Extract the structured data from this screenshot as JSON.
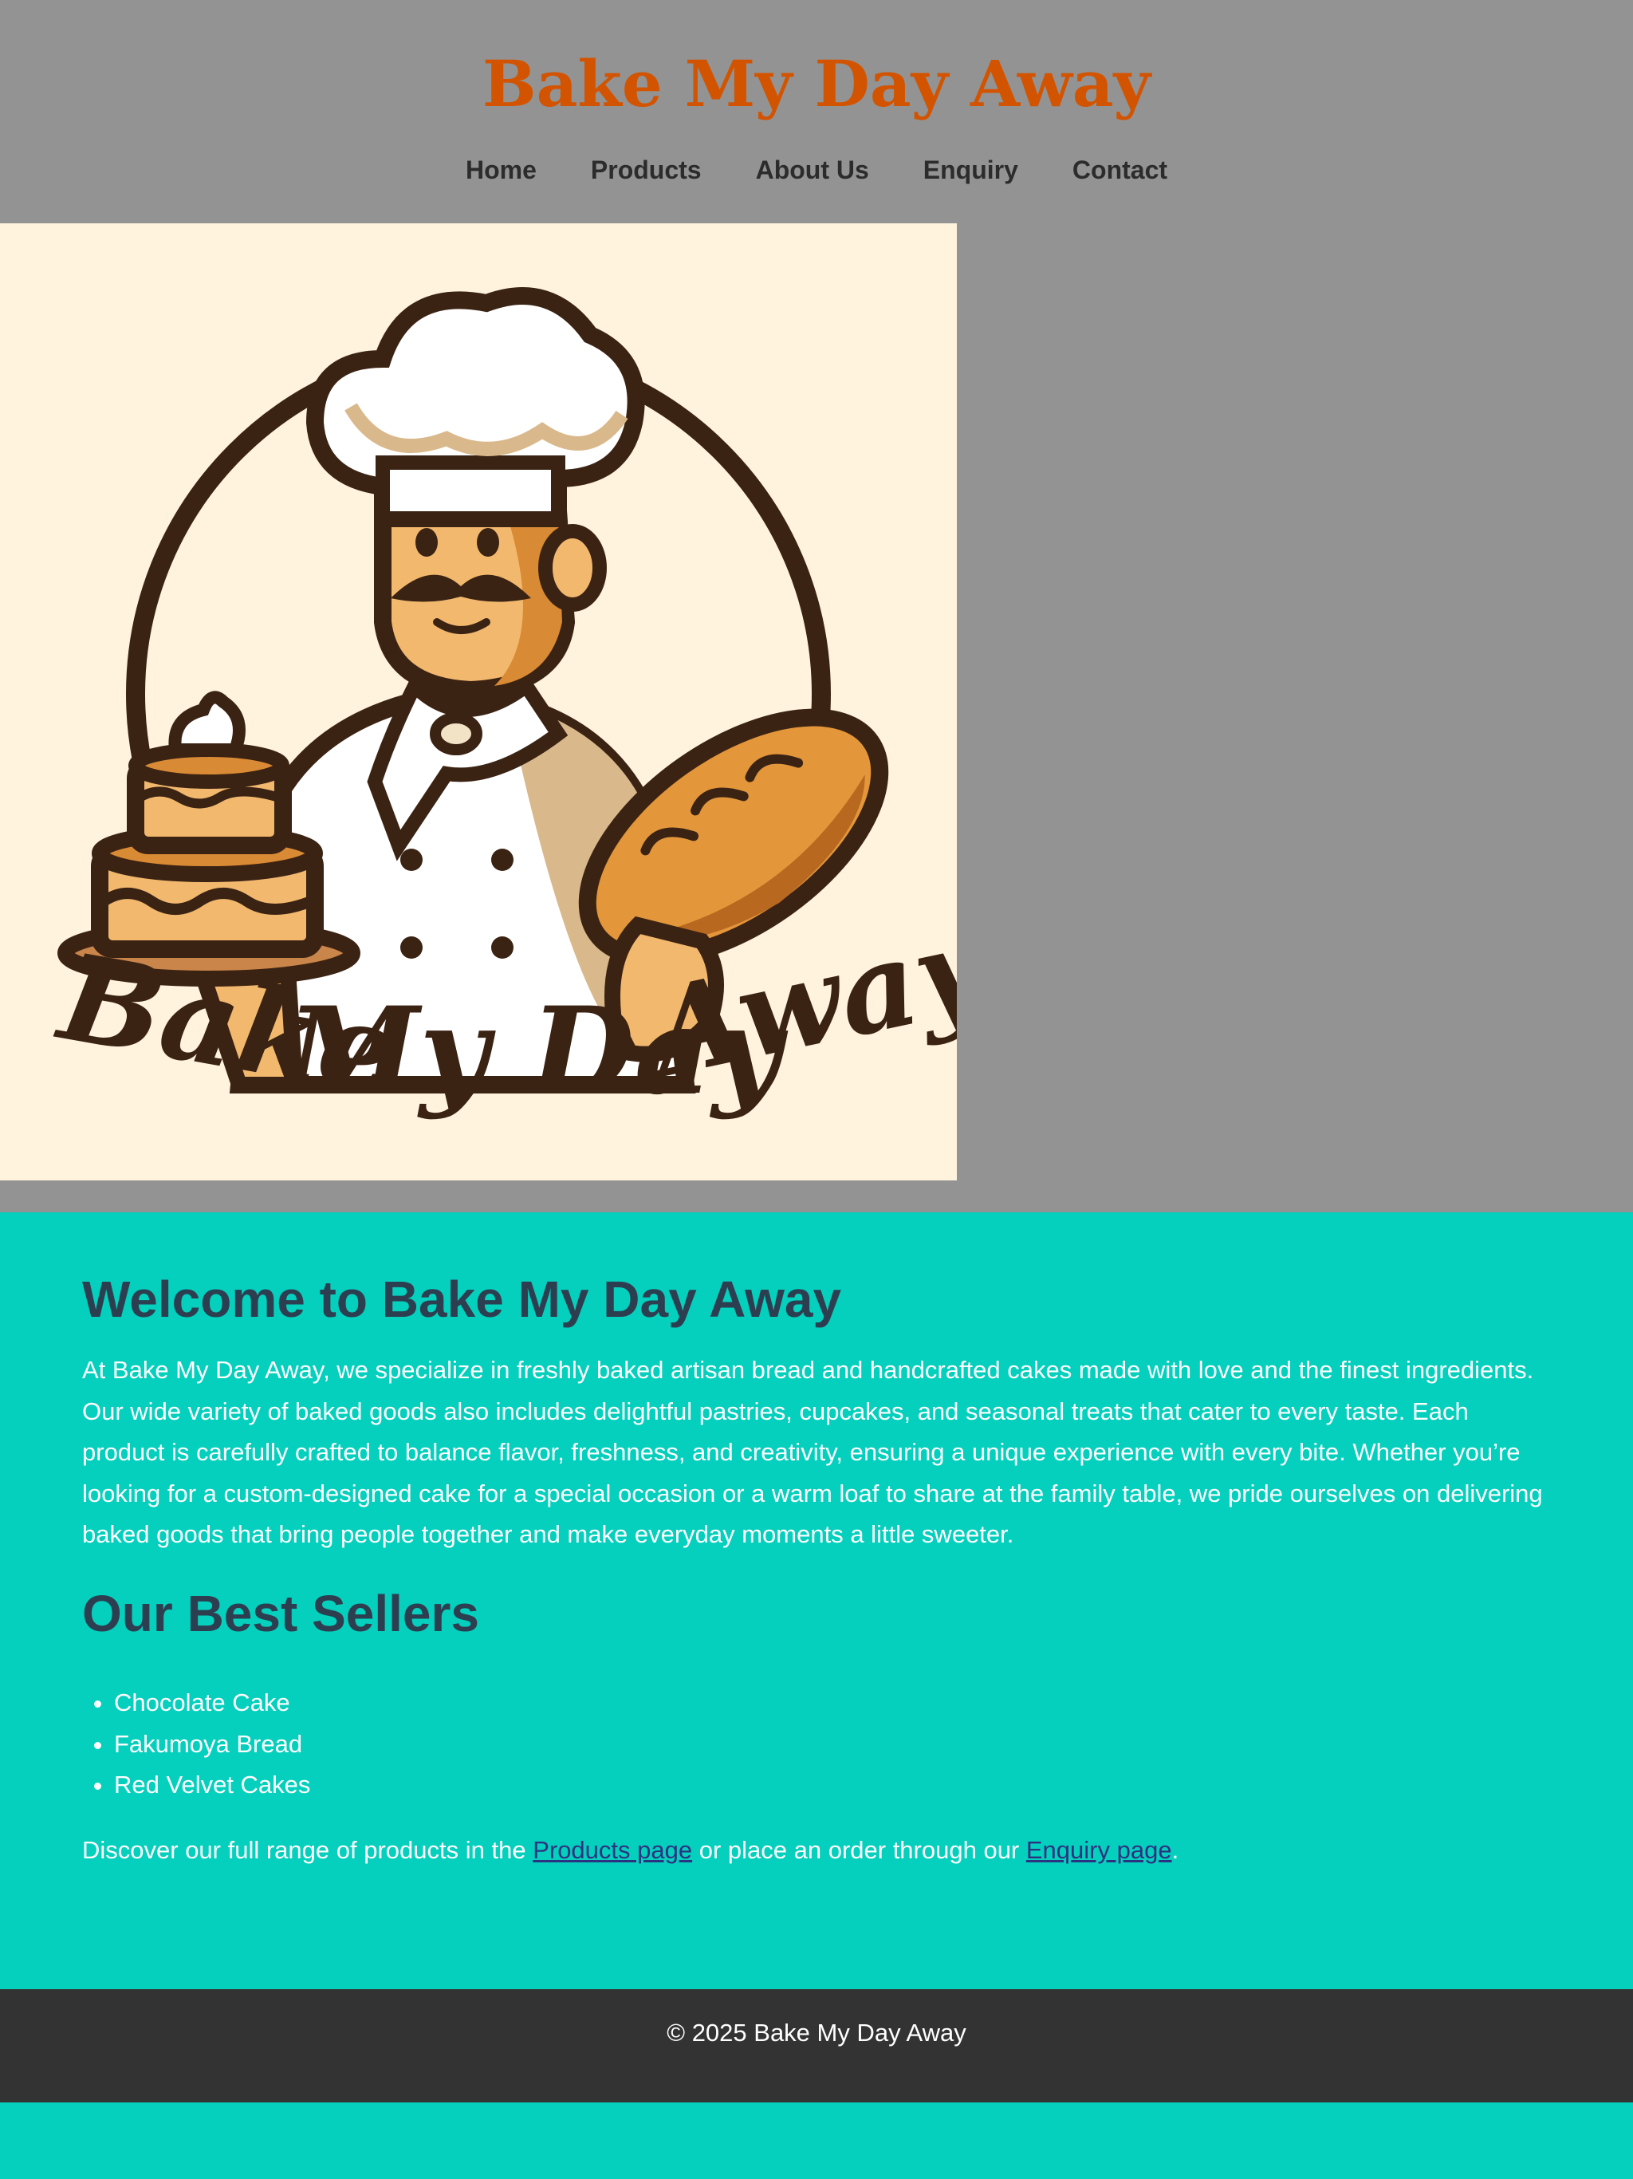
{
  "site": {
    "title": "Bake My Day Away"
  },
  "nav": {
    "items": [
      {
        "label": "Home"
      },
      {
        "label": "Products"
      },
      {
        "label": "About Us"
      },
      {
        "label": "Enquiry"
      },
      {
        "label": "Contact"
      }
    ]
  },
  "hero": {
    "logo_text_1": "Bake",
    "logo_text_2": "My Day",
    "logo_text_3": "Away"
  },
  "main": {
    "heading": "Welcome to Bake My Day Away",
    "intro": "At Bake My Day Away, we specialize in freshly baked artisan bread and handcrafted cakes made with love and the finest ingredients. Our wide variety of baked goods also includes delightful pastries, cupcakes, and seasonal treats that cater to every taste. Each product is carefully crafted to balance flavor, freshness, and creativity, ensuring a unique experience with every bite. Whether you’re looking for a custom-designed cake for a special occasion or a warm loaf to share at the family table, we pride ourselves on delivering baked goods that bring people together and make everyday moments a little sweeter.",
    "bestsellers_heading": "Our Best Sellers",
    "bestsellers": [
      "Chocolate Cake",
      "Fakumoya Bread",
      "Red Velvet Cakes"
    ],
    "discover": {
      "prefix": "Discover our full range of products in the ",
      "products_link": "Products page",
      "middle": " or place an order through our ",
      "enquiry_link": "Enquiry page",
      "suffix": "."
    }
  },
  "footer": {
    "text": "© 2025 Bake My Day Away"
  },
  "colors": {
    "header_bg": "#939393",
    "title": "#d35400",
    "content_bg": "#05cfbd",
    "heading": "#2c3e50",
    "footer_bg": "#333333"
  }
}
